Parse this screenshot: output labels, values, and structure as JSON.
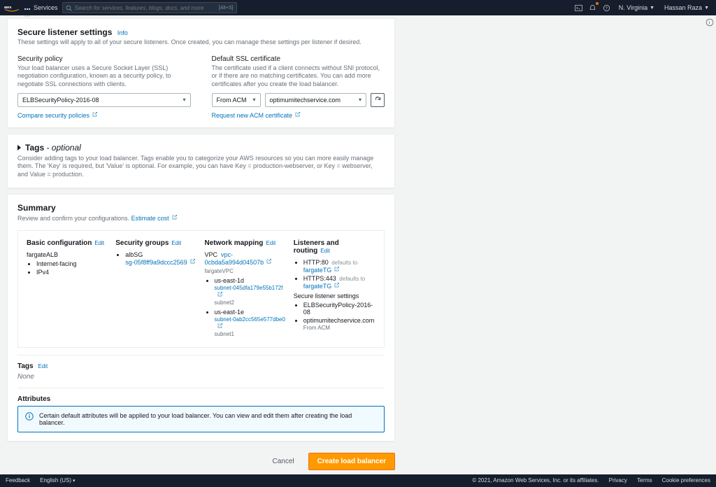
{
  "topnav": {
    "services": "Services",
    "search_placeholder": "Search for services, features, blogs, docs, and more",
    "shortcut": "[Alt+S]",
    "region": "N. Virginia",
    "user": "Hassan Raza"
  },
  "listener": {
    "title": "Secure listener settings",
    "info": "Info",
    "desc": "These settings will apply to all of your secure listeners. Once created, you can manage these settings per listener if desired.",
    "policy_label": "Security policy",
    "policy_help": "Your load balancer uses a Secure Socket Layer (SSL) negotiation configuration, known as a security policy, to negotiate SSL connections with clients.",
    "policy_value": "ELBSecurityPolicy-2016-08",
    "compare": "Compare security policies",
    "cert_label": "Default SSL certificate",
    "cert_help": "The certificate used if a client connects without SNI protocol, or if there are no matching certificates. You can add more certificates after you create the load balancer.",
    "cert_source": "From ACM",
    "cert_value": "optimumitechservice.com",
    "request_new": "Request new ACM certificate"
  },
  "tags": {
    "title": "Tags ",
    "optional": "- optional",
    "desc": "Consider adding tags to your load balancer. Tags enable you to categorize your AWS resources so you can more easily manage them. The 'Key' is required, but 'Value' is optional. For example, you can have Key = production-webserver, or Key = webserver, and Value = production."
  },
  "summary": {
    "title": "Summary",
    "desc": "Review and confirm your configurations. ",
    "estimate": "Estimate cost",
    "basic": {
      "title": "Basic configuration",
      "name": "fargateALB",
      "items": [
        "Internet-facing",
        "IPv4"
      ]
    },
    "sg": {
      "title": "Security groups",
      "name": "albSG",
      "id": "sg-05f8ff9a9dccc2569"
    },
    "network": {
      "title": "Network mapping",
      "vpc_label": "VPC",
      "vpc_link": "vpc-0cbda5a994d04507b",
      "vpc_name": "fargateVPC",
      "az1": "us-east-1d",
      "subnet1": "subnet-045dfa179e55b172f",
      "subnet1_name": "subnet2",
      "az2": "us-east-1e",
      "subnet2": "subnet-0ab2cc565e577dbe0",
      "subnet2_name": "subnet1"
    },
    "routing": {
      "title": "Listeners and routing",
      "l1": "HTTP:80",
      "l2": "HTTPS:443",
      "defaults_to": "defaults to",
      "tg": "fargateTG",
      "sls_title": "Secure listener settings",
      "policy": "ELBSecurityPolicy-2016-08",
      "cert": "optimumitechservice.com",
      "from_acm": "From ACM"
    },
    "tags_title": "Tags",
    "edit": "Edit",
    "none": "None",
    "attr_title": "Attributes",
    "attr_msg": "Certain default attributes will be applied to your load balancer. You can view and edit them after creating the load balancer."
  },
  "actions": {
    "cancel": "Cancel",
    "create": "Create load balancer"
  },
  "footer": {
    "feedback": "Feedback",
    "lang": "English (US)",
    "copyright": "© 2021, Amazon Web Services, Inc. or its affiliates.",
    "privacy": "Privacy",
    "terms": "Terms",
    "cookies": "Cookie preferences"
  }
}
